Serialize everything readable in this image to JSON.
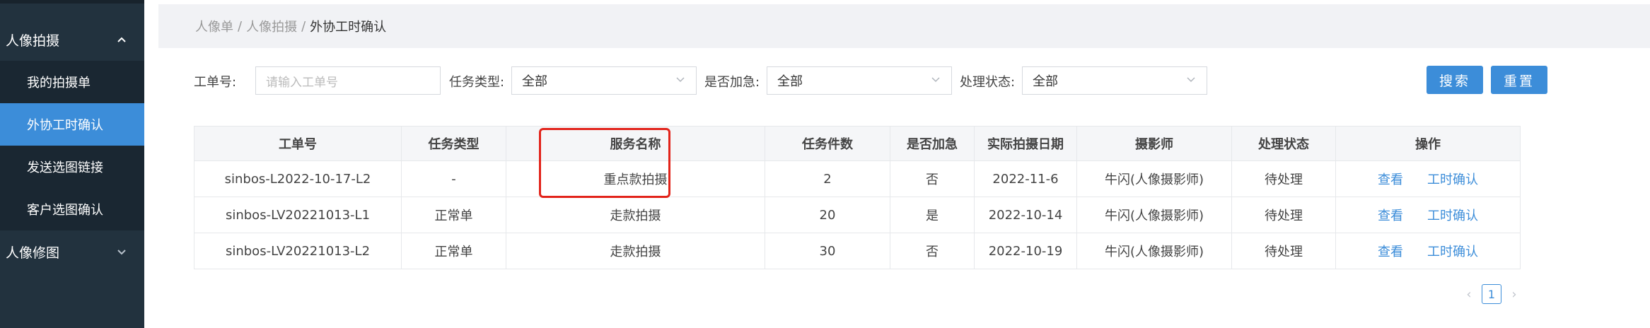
{
  "sidebar": {
    "groups": [
      {
        "label": "人像拍摄",
        "expanded": true
      },
      {
        "label": "人像修图",
        "expanded": false
      }
    ],
    "items": [
      {
        "label": "我的拍摄单",
        "active": false
      },
      {
        "label": "外协工时确认",
        "active": true
      },
      {
        "label": "发送选图链接",
        "active": false
      },
      {
        "label": "客户选图确认",
        "active": false
      }
    ],
    "colors": {
      "bg": "#22323e",
      "active": "#3c8dd9"
    }
  },
  "breadcrumb": {
    "items": [
      "人像单",
      "人像拍摄"
    ],
    "separator": "/",
    "current": "外协工时确认"
  },
  "filters": {
    "order_no": {
      "label": "工单号:",
      "placeholder": "请输入工单号",
      "value": ""
    },
    "task_type": {
      "label": "任务类型:",
      "value": "全部"
    },
    "urgent": {
      "label": "是否加急:",
      "value": "全部"
    },
    "status": {
      "label": "处理状态:",
      "value": "全部"
    },
    "search_label": "搜索",
    "reset_label": "重置"
  },
  "table": {
    "headers": [
      "工单号",
      "任务类型",
      "服务名称",
      "任务件数",
      "是否加急",
      "实际拍摄日期",
      "摄影师",
      "处理状态",
      "操作"
    ],
    "rows": [
      {
        "order_no": "sinbos-L2022-10-17-L2",
        "task_type": "-",
        "service": "重点款拍摄",
        "count": "2",
        "urgent": "否",
        "date": "2022-11-6",
        "photographer": "牛闪(人像摄影师)",
        "status": "待处理"
      },
      {
        "order_no": "sinbos-LV20221013-L1",
        "task_type": "正常单",
        "service": "走款拍摄",
        "count": "20",
        "urgent": "是",
        "date": "2022-10-14",
        "photographer": "牛闪(人像摄影师)",
        "status": "待处理"
      },
      {
        "order_no": "sinbos-LV20221013-L2",
        "task_type": "正常单",
        "service": "走款拍摄",
        "count": "30",
        "urgent": "否",
        "date": "2022-10-19",
        "photographer": "牛闪(人像摄影师)",
        "status": "待处理"
      }
    ],
    "actions": {
      "view": "查看",
      "confirm": "工时确认"
    }
  },
  "pagination": {
    "prev": "‹",
    "current": "1",
    "next": "›"
  },
  "colors": {
    "accent": "#3c8dd9",
    "highlight": "#e2231a"
  }
}
